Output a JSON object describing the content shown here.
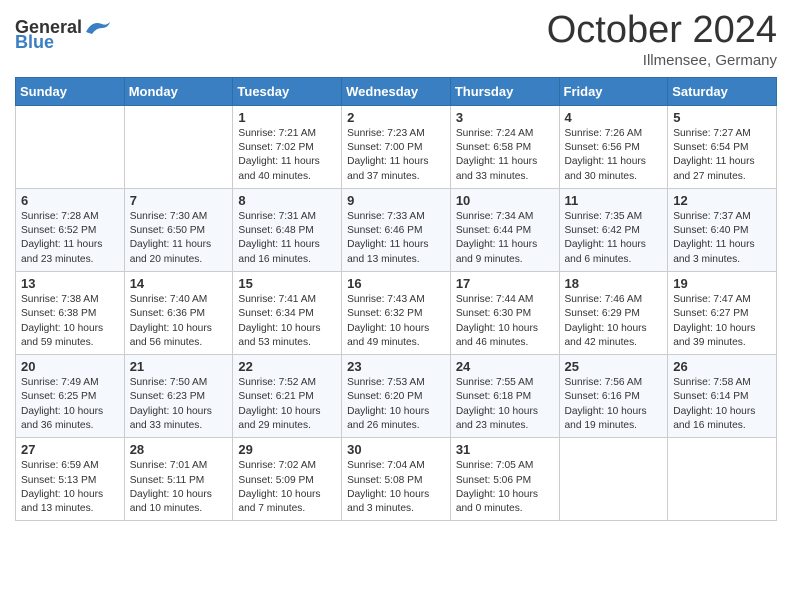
{
  "header": {
    "logo_general": "General",
    "logo_blue": "Blue",
    "month_title": "October 2024",
    "location": "Illmensee, Germany"
  },
  "weekdays": [
    "Sunday",
    "Monday",
    "Tuesday",
    "Wednesday",
    "Thursday",
    "Friday",
    "Saturday"
  ],
  "weeks": [
    [
      {
        "day": "",
        "text": ""
      },
      {
        "day": "",
        "text": ""
      },
      {
        "day": "1",
        "text": "Sunrise: 7:21 AM\nSunset: 7:02 PM\nDaylight: 11 hours and 40 minutes."
      },
      {
        "day": "2",
        "text": "Sunrise: 7:23 AM\nSunset: 7:00 PM\nDaylight: 11 hours and 37 minutes."
      },
      {
        "day": "3",
        "text": "Sunrise: 7:24 AM\nSunset: 6:58 PM\nDaylight: 11 hours and 33 minutes."
      },
      {
        "day": "4",
        "text": "Sunrise: 7:26 AM\nSunset: 6:56 PM\nDaylight: 11 hours and 30 minutes."
      },
      {
        "day": "5",
        "text": "Sunrise: 7:27 AM\nSunset: 6:54 PM\nDaylight: 11 hours and 27 minutes."
      }
    ],
    [
      {
        "day": "6",
        "text": "Sunrise: 7:28 AM\nSunset: 6:52 PM\nDaylight: 11 hours and 23 minutes."
      },
      {
        "day": "7",
        "text": "Sunrise: 7:30 AM\nSunset: 6:50 PM\nDaylight: 11 hours and 20 minutes."
      },
      {
        "day": "8",
        "text": "Sunrise: 7:31 AM\nSunset: 6:48 PM\nDaylight: 11 hours and 16 minutes."
      },
      {
        "day": "9",
        "text": "Sunrise: 7:33 AM\nSunset: 6:46 PM\nDaylight: 11 hours and 13 minutes."
      },
      {
        "day": "10",
        "text": "Sunrise: 7:34 AM\nSunset: 6:44 PM\nDaylight: 11 hours and 9 minutes."
      },
      {
        "day": "11",
        "text": "Sunrise: 7:35 AM\nSunset: 6:42 PM\nDaylight: 11 hours and 6 minutes."
      },
      {
        "day": "12",
        "text": "Sunrise: 7:37 AM\nSunset: 6:40 PM\nDaylight: 11 hours and 3 minutes."
      }
    ],
    [
      {
        "day": "13",
        "text": "Sunrise: 7:38 AM\nSunset: 6:38 PM\nDaylight: 10 hours and 59 minutes."
      },
      {
        "day": "14",
        "text": "Sunrise: 7:40 AM\nSunset: 6:36 PM\nDaylight: 10 hours and 56 minutes."
      },
      {
        "day": "15",
        "text": "Sunrise: 7:41 AM\nSunset: 6:34 PM\nDaylight: 10 hours and 53 minutes."
      },
      {
        "day": "16",
        "text": "Sunrise: 7:43 AM\nSunset: 6:32 PM\nDaylight: 10 hours and 49 minutes."
      },
      {
        "day": "17",
        "text": "Sunrise: 7:44 AM\nSunset: 6:30 PM\nDaylight: 10 hours and 46 minutes."
      },
      {
        "day": "18",
        "text": "Sunrise: 7:46 AM\nSunset: 6:29 PM\nDaylight: 10 hours and 42 minutes."
      },
      {
        "day": "19",
        "text": "Sunrise: 7:47 AM\nSunset: 6:27 PM\nDaylight: 10 hours and 39 minutes."
      }
    ],
    [
      {
        "day": "20",
        "text": "Sunrise: 7:49 AM\nSunset: 6:25 PM\nDaylight: 10 hours and 36 minutes."
      },
      {
        "day": "21",
        "text": "Sunrise: 7:50 AM\nSunset: 6:23 PM\nDaylight: 10 hours and 33 minutes."
      },
      {
        "day": "22",
        "text": "Sunrise: 7:52 AM\nSunset: 6:21 PM\nDaylight: 10 hours and 29 minutes."
      },
      {
        "day": "23",
        "text": "Sunrise: 7:53 AM\nSunset: 6:20 PM\nDaylight: 10 hours and 26 minutes."
      },
      {
        "day": "24",
        "text": "Sunrise: 7:55 AM\nSunset: 6:18 PM\nDaylight: 10 hours and 23 minutes."
      },
      {
        "day": "25",
        "text": "Sunrise: 7:56 AM\nSunset: 6:16 PM\nDaylight: 10 hours and 19 minutes."
      },
      {
        "day": "26",
        "text": "Sunrise: 7:58 AM\nSunset: 6:14 PM\nDaylight: 10 hours and 16 minutes."
      }
    ],
    [
      {
        "day": "27",
        "text": "Sunrise: 6:59 AM\nSunset: 5:13 PM\nDaylight: 10 hours and 13 minutes."
      },
      {
        "day": "28",
        "text": "Sunrise: 7:01 AM\nSunset: 5:11 PM\nDaylight: 10 hours and 10 minutes."
      },
      {
        "day": "29",
        "text": "Sunrise: 7:02 AM\nSunset: 5:09 PM\nDaylight: 10 hours and 7 minutes."
      },
      {
        "day": "30",
        "text": "Sunrise: 7:04 AM\nSunset: 5:08 PM\nDaylight: 10 hours and 3 minutes."
      },
      {
        "day": "31",
        "text": "Sunrise: 7:05 AM\nSunset: 5:06 PM\nDaylight: 10 hours and 0 minutes."
      },
      {
        "day": "",
        "text": ""
      },
      {
        "day": "",
        "text": ""
      }
    ]
  ]
}
